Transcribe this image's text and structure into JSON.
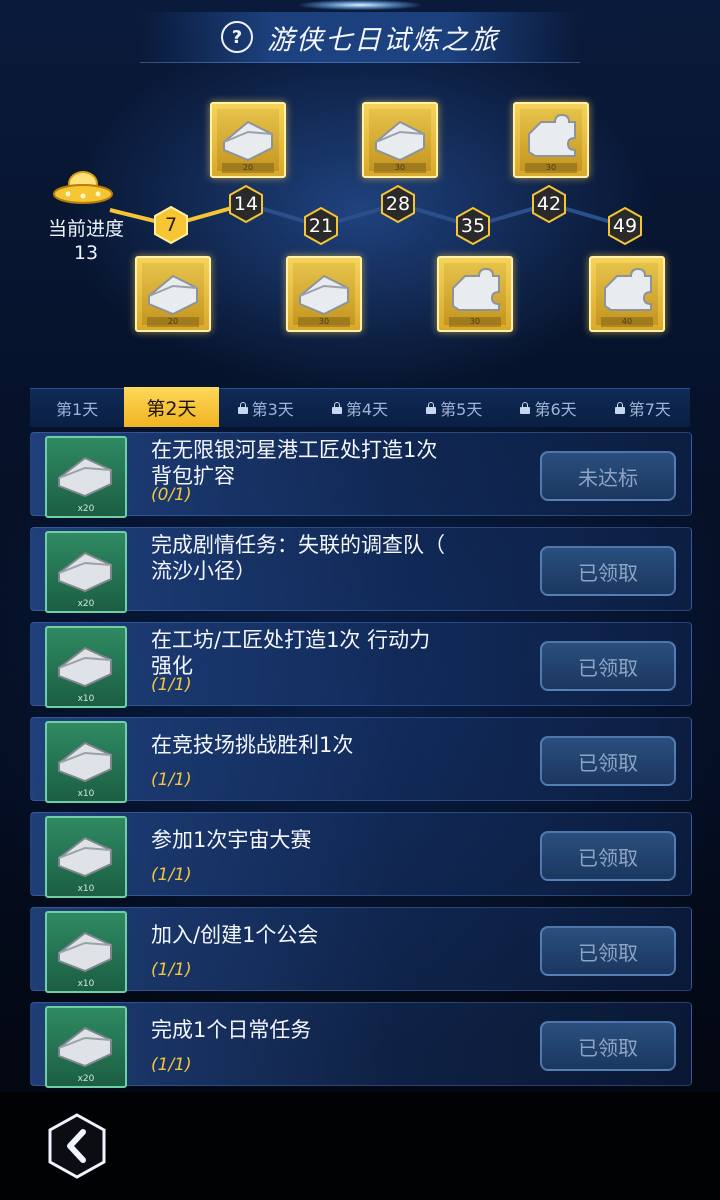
{
  "header": {
    "title": "游侠七日试炼之旅",
    "help_label": "?"
  },
  "progress": {
    "current_label": "当前进度",
    "current_value": "13",
    "current_numeric": 13,
    "milestones": [
      {
        "label": "7",
        "reached": true,
        "reward_qty": "20",
        "reward": "chest-icon"
      },
      {
        "label": "14",
        "reached": false,
        "reward_qty": "20",
        "reward": "chest-icon"
      },
      {
        "label": "21",
        "reached": false,
        "reward_qty": "30",
        "reward": "chest-icon"
      },
      {
        "label": "28",
        "reached": false,
        "reward_qty": "30",
        "reward": "chest-icon"
      },
      {
        "label": "35",
        "reached": false,
        "reward_qty": "30",
        "reward": "puzzle-icon"
      },
      {
        "label": "42",
        "reached": false,
        "reward_qty": "30",
        "reward": "puzzle-icon"
      },
      {
        "label": "49",
        "reached": false,
        "reward_qty": "40",
        "reward": "puzzle-icon"
      }
    ]
  },
  "tabs": [
    {
      "label": "第1天",
      "locked": false,
      "active": false
    },
    {
      "label": "第2天",
      "locked": false,
      "active": true
    },
    {
      "label": "第3天",
      "locked": true,
      "active": false
    },
    {
      "label": "第4天",
      "locked": true,
      "active": false
    },
    {
      "label": "第5天",
      "locked": true,
      "active": false
    },
    {
      "label": "第6天",
      "locked": true,
      "active": false
    },
    {
      "label": "第7天",
      "locked": true,
      "active": false
    }
  ],
  "tasks": [
    {
      "title_line1": "在无限银河星港工匠处打造1次",
      "title_line2": "背包扩容",
      "progress": "(0/1)",
      "reward_qty": "x20",
      "button": "未达标"
    },
    {
      "title_line1": "完成剧情任务：失联的调查队（",
      "title_line2": "流沙小径）",
      "progress": "",
      "reward_qty": "x20",
      "button": "已领取"
    },
    {
      "title_line1": "在工坊/工匠处打造1次 行动力",
      "title_line2": "强化",
      "progress": "(1/1)",
      "reward_qty": "x10",
      "button": "已领取"
    },
    {
      "title_line1": "在竞技场挑战胜利1次",
      "title_line2": "",
      "progress": "(1/1)",
      "reward_qty": "x10",
      "button": "已领取"
    },
    {
      "title_line1": "参加1次宇宙大赛",
      "title_line2": "",
      "progress": "(1/1)",
      "reward_qty": "x10",
      "button": "已领取"
    },
    {
      "title_line1": "加入/创建1个公会",
      "title_line2": "",
      "progress": "(1/1)",
      "reward_qty": "x10",
      "button": "已领取"
    },
    {
      "title_line1": "完成1个日常任务",
      "title_line2": "",
      "progress": "(1/1)",
      "reward_qty": "x20",
      "button": "已领取"
    }
  ],
  "colors": {
    "accent": "#f5c533",
    "panel": "#1c3a6a",
    "reward_bg": "#2f8a63",
    "progress_text": "#f2c640"
  },
  "icons": {
    "back": "chevron-left-icon",
    "help": "question-icon",
    "progress_marker": "ufo-icon",
    "task_reward": "chest-icon",
    "lock": "lock-icon"
  }
}
